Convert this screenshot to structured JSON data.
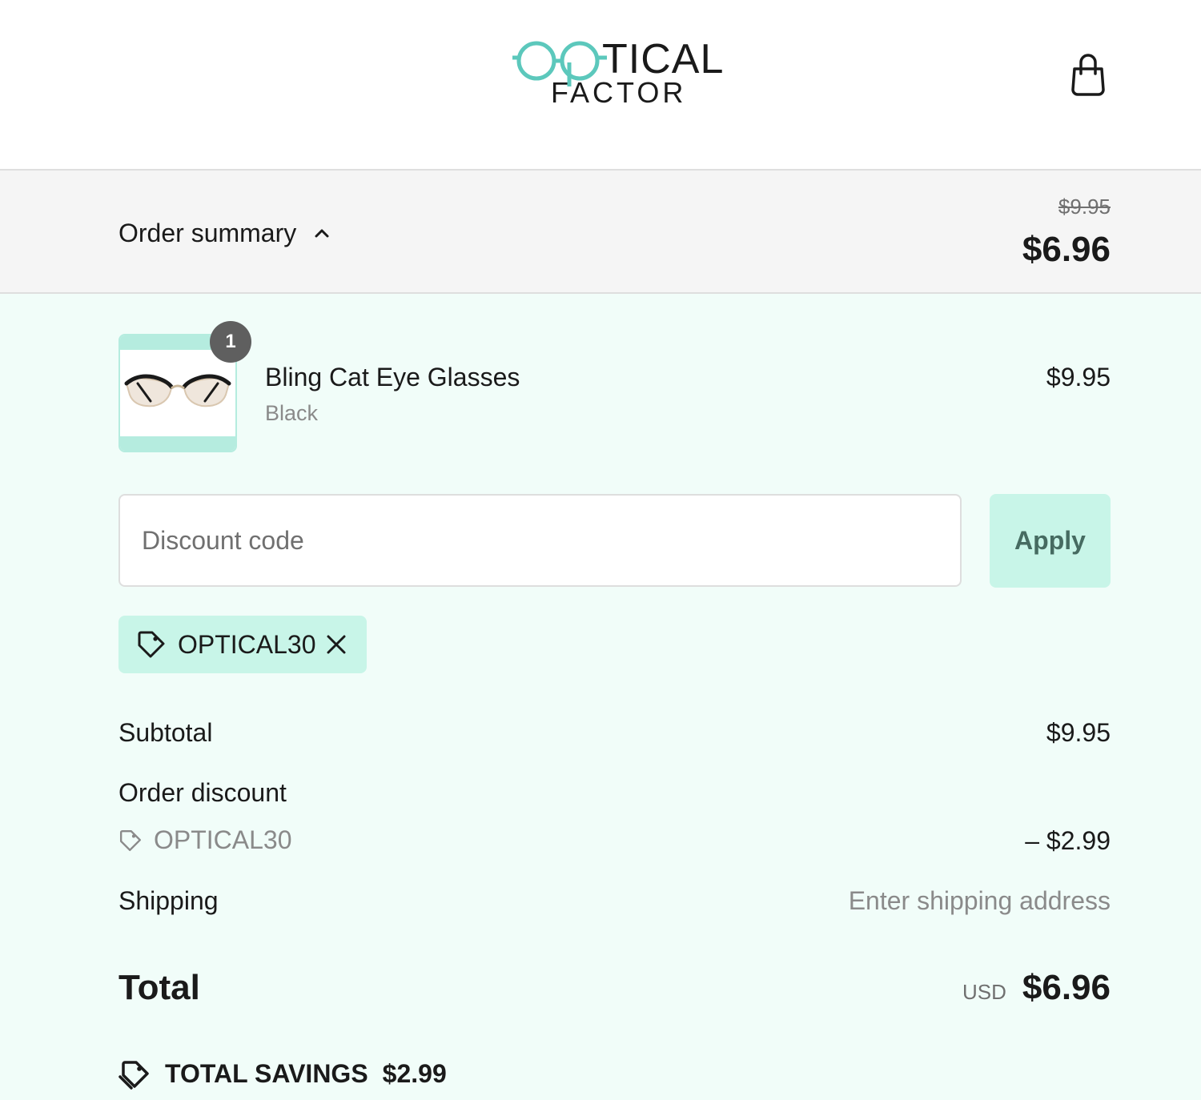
{
  "header": {
    "logo_top": "TICAL",
    "logo_bottom": "FACTOR",
    "logo_accent": "#5cc8bc",
    "cart_icon": "shopping-bag-icon"
  },
  "summary": {
    "toggle_label": "Order summary",
    "toggle_icon": "chevron-up-icon",
    "original_total": "$9.95",
    "total": "$6.96"
  },
  "line_items": [
    {
      "name": "Bling Cat Eye Glasses",
      "variant": "Black",
      "quantity": "1",
      "price": "$9.95"
    }
  ],
  "discount": {
    "placeholder": "Discount code",
    "value": "",
    "apply_label": "Apply",
    "applied_code": "OPTICAL30",
    "tag_icon": "tag-icon",
    "remove_icon": "close-icon"
  },
  "totals": {
    "subtotal_label": "Subtotal",
    "subtotal_value": "$9.95",
    "order_discount_label": "Order discount",
    "order_discount_code": "OPTICAL30",
    "order_discount_value": "– $2.99",
    "shipping_label": "Shipping",
    "shipping_value": "Enter shipping address",
    "total_label": "Total",
    "currency": "USD",
    "total_value": "$6.96",
    "savings_label": "TOTAL SAVINGS",
    "savings_value": "$2.99"
  },
  "colors": {
    "panel_bg": "#f1fdf9",
    "accent_mint": "#c8f5e8",
    "summary_bg": "#f5f5f5"
  }
}
